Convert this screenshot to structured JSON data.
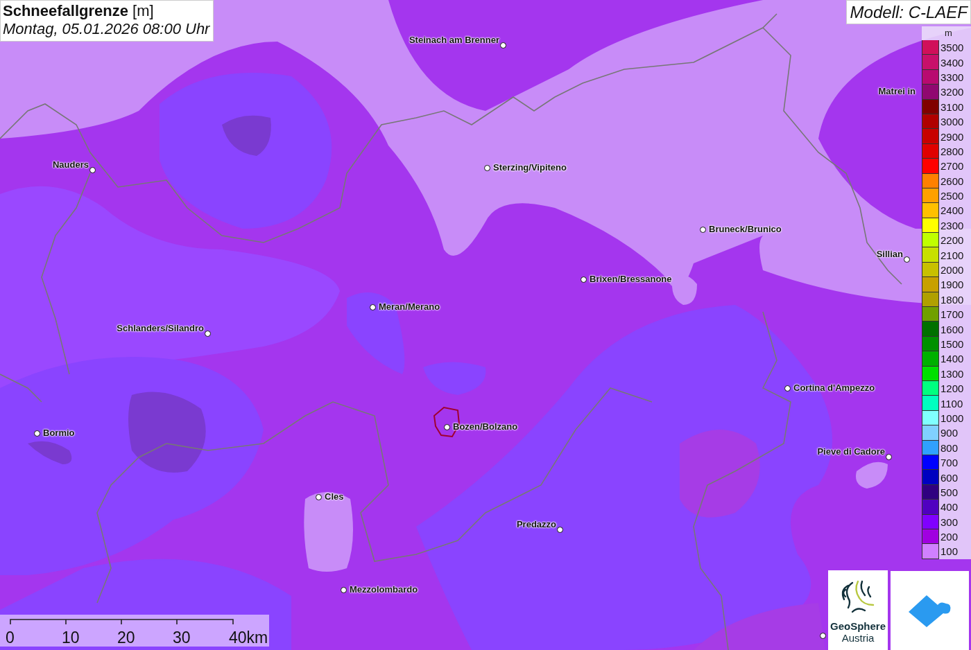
{
  "title": {
    "heading": "**Schneefallgrenze** [m]",
    "datetime": "Montag, 05.01.2026 08:00 Uhr"
  },
  "model": "Modell: C-LAEF",
  "cities": [
    {
      "name": "Steinach am Brenner"
    },
    {
      "name": "Nauders"
    },
    {
      "name": "Sterzing/Vipiteno"
    },
    {
      "name": "Bruneck/Brunico"
    },
    {
      "name": "Matrei in"
    },
    {
      "name": "Sillian"
    },
    {
      "name": "Brixen/Bressanone"
    },
    {
      "name": "Meran/Merano"
    },
    {
      "name": "Schlanders/Silandro"
    },
    {
      "name": "Cortina d'Ampezzo"
    },
    {
      "name": "Bormio"
    },
    {
      "name": "Bozen/Bolzano"
    },
    {
      "name": "Pieve di Cadore"
    },
    {
      "name": "Cles"
    },
    {
      "name": "Predazzo"
    },
    {
      "name": "Mezzolombardo"
    }
  ],
  "legend": {
    "unit": "m",
    "items": [
      {
        "label": "3500",
        "color": "#d0105a"
      },
      {
        "label": "3400",
        "color": "#c8106a"
      },
      {
        "label": "3300",
        "color": "#b80a70"
      },
      {
        "label": "3200",
        "color": "#900870"
      },
      {
        "label": "3100",
        "color": "#800000"
      },
      {
        "label": "3000",
        "color": "#b00000"
      },
      {
        "label": "2900",
        "color": "#c80000"
      },
      {
        "label": "2800",
        "color": "#e00000"
      },
      {
        "label": "2700",
        "color": "#ff0000"
      },
      {
        "label": "2600",
        "color": "#ff8000"
      },
      {
        "label": "2500",
        "color": "#ffa000"
      },
      {
        "label": "2400",
        "color": "#ffc000"
      },
      {
        "label": "2300",
        "color": "#ffff00"
      },
      {
        "label": "2200",
        "color": "#c0ff00"
      },
      {
        "label": "2100",
        "color": "#c8e000"
      },
      {
        "label": "2000",
        "color": "#c8c000"
      },
      {
        "label": "1900",
        "color": "#c8a000"
      },
      {
        "label": "1800",
        "color": "#b0a000"
      },
      {
        "label": "1700",
        "color": "#70a000"
      },
      {
        "label": "1600",
        "color": "#007000"
      },
      {
        "label": "1500",
        "color": "#009000"
      },
      {
        "label": "1400",
        "color": "#00b000"
      },
      {
        "label": "1300",
        "color": "#00e000"
      },
      {
        "label": "1200",
        "color": "#00ff80"
      },
      {
        "label": "1100",
        "color": "#00ffc0"
      },
      {
        "label": "1000",
        "color": "#80ffff"
      },
      {
        "label": "900",
        "color": "#80d0ff"
      },
      {
        "label": "800",
        "color": "#30a0ff"
      },
      {
        "label": "700",
        "color": "#0000ff"
      },
      {
        "label": "600",
        "color": "#0000c0"
      },
      {
        "label": "500",
        "color": "#300080"
      },
      {
        "label": "400",
        "color": "#5000c0"
      },
      {
        "label": "300",
        "color": "#8000ff"
      },
      {
        "label": "200",
        "color": "#a000e0"
      },
      {
        "label": "100",
        "color": "#d080ff"
      }
    ]
  },
  "scale": {
    "ticks": [
      "0",
      "10",
      "20",
      "30",
      "40km"
    ]
  },
  "logo": {
    "name": "GeoSphere",
    "country": "Austria"
  }
}
